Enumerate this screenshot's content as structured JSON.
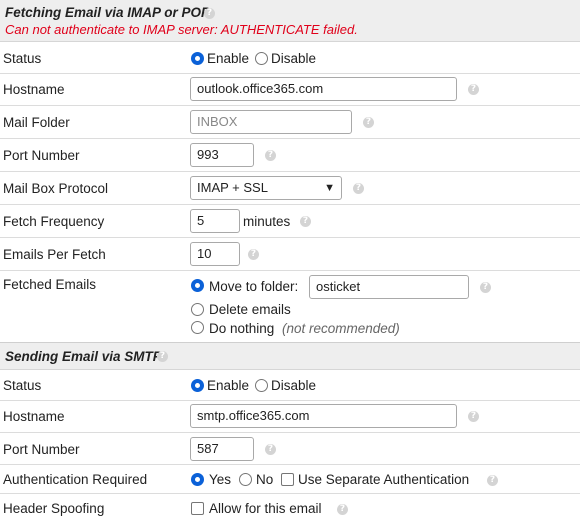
{
  "imap_section": {
    "title": "Fetching Email via IMAP or POP",
    "error": "Can not authenticate to IMAP server: AUTHENTICATE failed."
  },
  "imap": {
    "status": {
      "label": "Status",
      "enable": "Enable",
      "disable": "Disable",
      "selected": "Enable"
    },
    "hostname": {
      "label": "Hostname",
      "value": "outlook.office365.com"
    },
    "mail_folder": {
      "label": "Mail Folder",
      "placeholder": "INBOX"
    },
    "port": {
      "label": "Port Number",
      "value": "993"
    },
    "protocol": {
      "label": "Mail Box Protocol",
      "value": "IMAP + SSL"
    },
    "frequency": {
      "label": "Fetch Frequency",
      "value": "5",
      "unit": "minutes"
    },
    "per_fetch": {
      "label": "Emails Per Fetch",
      "value": "10"
    },
    "fetched": {
      "label": "Fetched Emails",
      "move": "Move to folder:",
      "folder": "osticket",
      "delete": "Delete emails",
      "nothing": "Do nothing",
      "nothing_note": "(not recommended)",
      "selected": "Move to folder:"
    }
  },
  "smtp_section": {
    "title": "Sending Email via SMTP"
  },
  "smtp": {
    "status": {
      "label": "Status",
      "enable": "Enable",
      "disable": "Disable",
      "selected": "Enable"
    },
    "hostname": {
      "label": "Hostname",
      "value": "smtp.office365.com"
    },
    "port": {
      "label": "Port Number",
      "value": "587"
    },
    "auth": {
      "label": "Authentication Required",
      "yes": "Yes",
      "no": "No",
      "separate": "Use Separate Authentication",
      "selected": "Yes"
    },
    "spoofing": {
      "label": "Header Spoofing",
      "allow": "Allow for this email"
    }
  },
  "icons": {
    "help": "help-icon",
    "radio_color": "#0b61d8",
    "error_color": "#e0001a"
  }
}
